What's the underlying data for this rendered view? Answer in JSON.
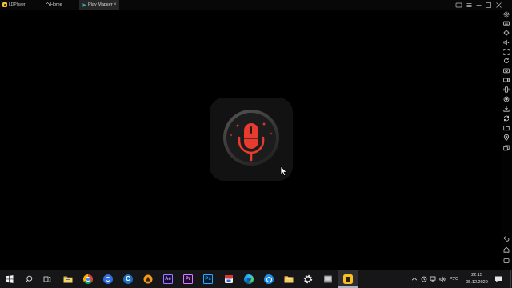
{
  "titlebar": {
    "logo_icon": "ldplayer-logo-icon",
    "app_name": "LDPlayer",
    "tabs": [
      {
        "label": "Home",
        "icon": "home-icon",
        "active": false
      },
      {
        "label": "Play Маркет",
        "icon": "play-store-icon",
        "close": "×",
        "active": true
      }
    ],
    "controls": [
      "keyboard-icon",
      "menu-icon",
      "minimize-icon",
      "maximize-icon",
      "close-icon"
    ]
  },
  "screen": {
    "app_icon": "microphone-icon",
    "decoration_icon": "sparkle-icon",
    "cursor": "mouse-cursor-icon"
  },
  "sidebar": {
    "top_icons": [
      "settings-icon",
      "keyboard-icon",
      "joystick-icon",
      "volume-up-icon",
      "fullscreen-icon",
      "rotate-icon",
      "screenshot-icon",
      "video-record-icon",
      "shake-icon",
      "operation-record-icon",
      "apk-install-icon",
      "sync-icon",
      "shared-folder-icon",
      "location-icon",
      "multi-instance-icon"
    ],
    "bottom_icons": [
      "back-icon",
      "home-icon",
      "recent-apps-icon"
    ]
  },
  "taskbar": {
    "start_icon": "windows-start-icon",
    "search_icon": "search-icon",
    "task_view_icon": "task-view-icon",
    "apps": [
      {
        "icon": "file-explorer-icon"
      },
      {
        "icon": "chrome-icon"
      },
      {
        "icon": "blue-app-icon"
      },
      {
        "icon": "c-app-icon",
        "label": "C"
      },
      {
        "icon": "orange-app-icon"
      },
      {
        "icon": "after-effects-icon",
        "label": "Ae"
      },
      {
        "icon": "premiere-pro-icon",
        "label": "Pr"
      },
      {
        "icon": "photoshop-icon",
        "label": "Ps"
      },
      {
        "icon": "red-app-icon"
      },
      {
        "icon": "edge-icon"
      },
      {
        "icon": "blue-swirl-app-icon"
      },
      {
        "icon": "folder-app-icon"
      },
      {
        "icon": "settings-icon"
      },
      {
        "icon": "monitor-app-icon"
      },
      {
        "icon": "ldplayer-icon",
        "active": true
      }
    ],
    "tray": {
      "icons": [
        "chevron-up-icon",
        "tray-app-icon",
        "network-icon",
        "volume-icon"
      ],
      "language": "РУС",
      "time": "22:15",
      "date": "05.12.2020",
      "notification_icon": "notification-icon"
    }
  },
  "colors": {
    "accent_red": "#e63b2e",
    "ldplayer_yellow": "#f5c125",
    "taskbar_bg": "#161618",
    "active_tab_bg": "#262626"
  }
}
